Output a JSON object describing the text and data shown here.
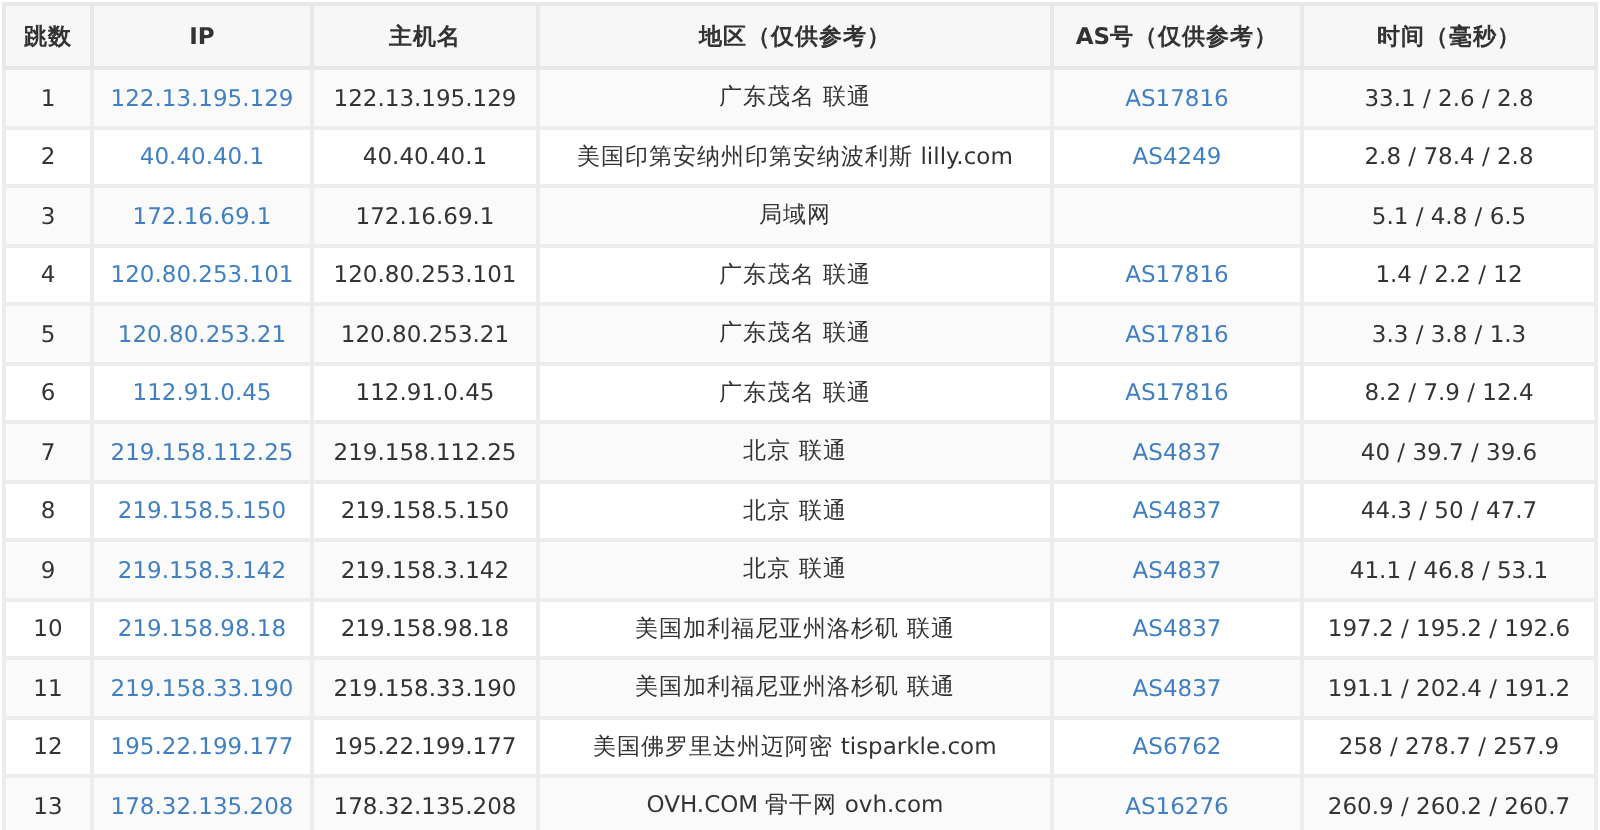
{
  "table": {
    "columns": [
      "跳数",
      "IP",
      "主机名",
      "地区（仅供参考）",
      "AS号（仅供参考）",
      "时间（毫秒）"
    ],
    "rows": [
      {
        "hop": "1",
        "ip": "122.13.195.129",
        "host": "122.13.195.129",
        "region": "广东茂名 联通",
        "as": "AS17816",
        "time": "33.1 / 2.6 / 2.8"
      },
      {
        "hop": "2",
        "ip": "40.40.40.1",
        "host": "40.40.40.1",
        "region": "美国印第安纳州印第安纳波利斯 lilly.com",
        "as": "AS4249",
        "time": "2.8 / 78.4 / 2.8"
      },
      {
        "hop": "3",
        "ip": "172.16.69.1",
        "host": "172.16.69.1",
        "region": "局域网",
        "time": "5.1 / 4.8 / 6.5"
      },
      {
        "hop": "4",
        "ip": "120.80.253.101",
        "host": "120.80.253.101",
        "region": "广东茂名 联通",
        "as": "AS17816",
        "time": "1.4 / 2.2 / 12"
      },
      {
        "hop": "5",
        "ip": "120.80.253.21",
        "host": "120.80.253.21",
        "region": "广东茂名 联通",
        "as": "AS17816",
        "time": "3.3 / 3.8 / 1.3"
      },
      {
        "hop": "6",
        "ip": "112.91.0.45",
        "host": "112.91.0.45",
        "region": "广东茂名 联通",
        "as": "AS17816",
        "time": "8.2 / 7.9 / 12.4"
      },
      {
        "hop": "7",
        "ip": "219.158.112.25",
        "host": "219.158.112.25",
        "region": "北京 联通",
        "as": "AS4837",
        "time": "40 / 39.7 / 39.6"
      },
      {
        "hop": "8",
        "ip": "219.158.5.150",
        "host": "219.158.5.150",
        "region": "北京 联通",
        "as": "AS4837",
        "time": "44.3 / 50 / 47.7"
      },
      {
        "hop": "9",
        "ip": "219.158.3.142",
        "host": "219.158.3.142",
        "region": "北京 联通",
        "as": "AS4837",
        "time": "41.1 / 46.8 / 53.1"
      },
      {
        "hop": "10",
        "ip": "219.158.98.18",
        "host": "219.158.98.18",
        "region": "美国加利福尼亚州洛杉矶 联通",
        "as": "AS4837",
        "time": "197.2 / 195.2 / 192.6"
      },
      {
        "hop": "11",
        "ip": "219.158.33.190",
        "host": "219.158.33.190",
        "region": "美国加利福尼亚州洛杉矶 联通",
        "as": "AS4837",
        "time": "191.1 / 202.4 / 191.2"
      },
      {
        "hop": "12",
        "ip": "195.22.199.177",
        "host": "195.22.199.177",
        "region": "美国佛罗里达州迈阿密 tisparkle.com",
        "as": "AS6762",
        "time": "258 / 278.7 / 257.9"
      },
      {
        "hop": "13",
        "ip": "178.32.135.208",
        "host": "178.32.135.208",
        "region": "OVH.COM 骨干网 ovh.com",
        "as": "AS16276",
        "time": "260.9 / 260.2 / 260.7"
      }
    ]
  }
}
